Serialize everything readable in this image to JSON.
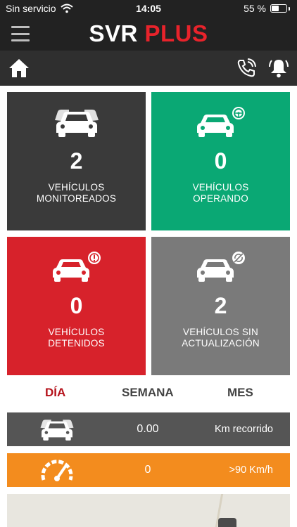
{
  "status_bar": {
    "carrier": "Sin servicio",
    "time": "14:05",
    "battery_text": "55 %",
    "battery_level": 0.55
  },
  "app": {
    "logo_left": "SVR",
    "logo_right": "PLUS"
  },
  "colors": {
    "brand_red": "#e8232b",
    "monitoreados": "#3a3a3a",
    "operando": "#0aa874",
    "detenidos": "#d7222b",
    "sin_actualizacion": "#7a7a7a",
    "active_tab": "#b5121b",
    "km_row": "#555555",
    "speed_row": "#f38c1e"
  },
  "tiles": [
    {
      "count": "2",
      "label_line1": "VEHÍCULOS",
      "label_line2": "MONITOREADOS",
      "icon": "car-fleet-icon"
    },
    {
      "count": "0",
      "label_line1": "VEHÍCULOS",
      "label_line2": "OPERANDO",
      "icon": "car-steering-icon"
    },
    {
      "count": "0",
      "label_line1": "VEHÍCULOS",
      "label_line2": "DETENIDOS",
      "icon": "car-alert-icon"
    },
    {
      "count": "2",
      "label_line1": "VEHÍCULOS SIN",
      "label_line2": "ACTUALIZACIÓN",
      "icon": "car-no-sync-icon"
    }
  ],
  "tabs": [
    {
      "label": "DÍA",
      "active": true
    },
    {
      "label": "SEMANA",
      "active": false
    },
    {
      "label": "MES",
      "active": false
    }
  ],
  "stats": [
    {
      "value": "0.00",
      "label": "Km recorrido",
      "icon": "car-fleet-icon"
    },
    {
      "value": "0",
      "label": ">90 Km/h",
      "icon": "speedometer-icon"
    }
  ]
}
